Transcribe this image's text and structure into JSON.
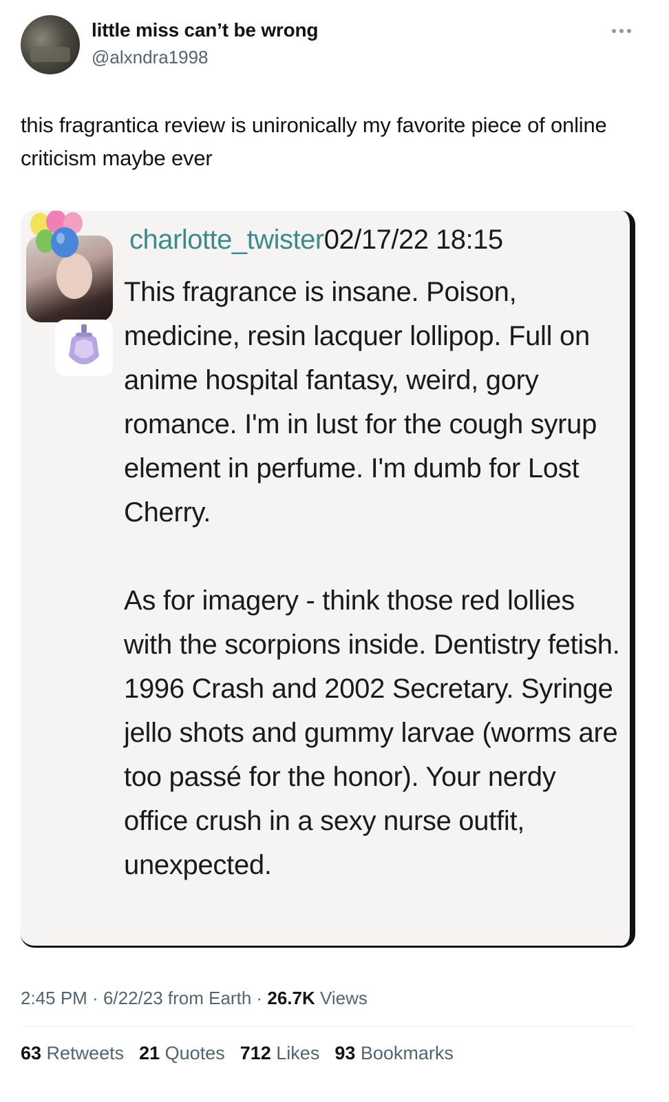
{
  "author": {
    "display_name": "little miss can’t be wrong",
    "handle": "@alxndra1998"
  },
  "tweet": {
    "text": "this fragrantica review is unironically my favorite piece of online criticism maybe ever"
  },
  "review": {
    "reviewer": "charlotte_twister",
    "date": "02/17/22 18:15",
    "paragraphs": [
      "This fragrance is insane. Poison, medicine, resin lacquer lollipop. Full on anime hospital fantasy, weird, gory romance. I'm in lust for the cough syrup element in perfume. I'm dumb for Lost Cherry.",
      "As for imagery - think those red lollies with the scorpions inside. Dentistry fetish. 1996 Crash and 2002 Secretary. Syringe jello shots and gummy larvae (worms are too passé for the honor). Your nerdy office crush in a sexy nurse outfit, unexpected."
    ]
  },
  "meta": {
    "time": "2:45 PM",
    "sep1": " · ",
    "date": "6/22/23",
    "source": " from Earth",
    "sep2": " · ",
    "views_count": "26.7K",
    "views_label": " Views"
  },
  "stats": {
    "retweets_count": "63",
    "retweets_label": " Retweets",
    "quotes_count": "21",
    "quotes_label": " Quotes",
    "likes_count": "712",
    "likes_label": " Likes",
    "bookmarks_count": "93",
    "bookmarks_label": " Bookmarks"
  },
  "colors": {
    "reviewer_name": "#3d8a8c",
    "secondary_text": "#536471",
    "media_background": "#f6f4f2"
  },
  "icons": [
    "more-icon",
    "balloons-icon",
    "perfume-bottle-icon"
  ]
}
